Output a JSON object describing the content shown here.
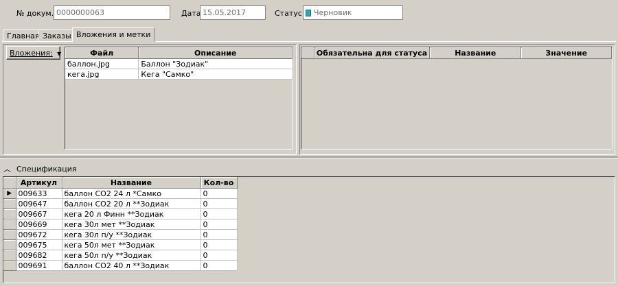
{
  "header": {
    "doc_num_label": "№ докум.",
    "doc_num_value": "0000000063",
    "date_label": "Дата",
    "date_value": "15.05.2017",
    "status_label": "Статус",
    "status_value": "Черновик",
    "status_icon": "document-status-icon",
    "status_icon_color": "#2aa6b8"
  },
  "tabs": [
    {
      "label": "Главная",
      "active": false
    },
    {
      "label": "Заказы",
      "active": false
    },
    {
      "label": "Вложения и метки",
      "active": true
    }
  ],
  "attachments": {
    "button_label": "Вложения:",
    "columns": [
      "Файл",
      "Описание"
    ],
    "rows": [
      {
        "file": "баллон.jpg",
        "description": "Баллон \"Зодиак\""
      },
      {
        "file": "кега.jpg",
        "description": "Кега \"Самко\""
      }
    ]
  },
  "tags": {
    "columns": [
      "",
      "Обязательна для статуса",
      "Название",
      "Значение"
    ]
  },
  "specification": {
    "title": "Спецификация",
    "collapse_icon": "chevron-up-icon",
    "columns": [
      "Артикул",
      "Название",
      "Кол-во"
    ],
    "rows": [
      {
        "sku": "009633",
        "name": "баллон СО2 24 л  *Самко",
        "qty": "0",
        "current": true
      },
      {
        "sku": "009647",
        "name": "баллон СО2 20 л  **Зодиак",
        "qty": "0"
      },
      {
        "sku": "009667",
        "name": "кега 20 л Финн **Зодиак",
        "qty": "0"
      },
      {
        "sku": "009669",
        "name": "кега 30л мет **Зодиак",
        "qty": "0"
      },
      {
        "sku": "009672",
        "name": "кега 30л п/у **Зодиак",
        "qty": "0"
      },
      {
        "sku": "009675",
        "name": "кега 50л мет **Зодиак",
        "qty": "0"
      },
      {
        "sku": "009682",
        "name": "кега 50л п/у **Зодиак",
        "qty": "0"
      },
      {
        "sku": "009691",
        "name": "баллон СО2 40 л  **Зодиак",
        "qty": "0"
      }
    ]
  }
}
